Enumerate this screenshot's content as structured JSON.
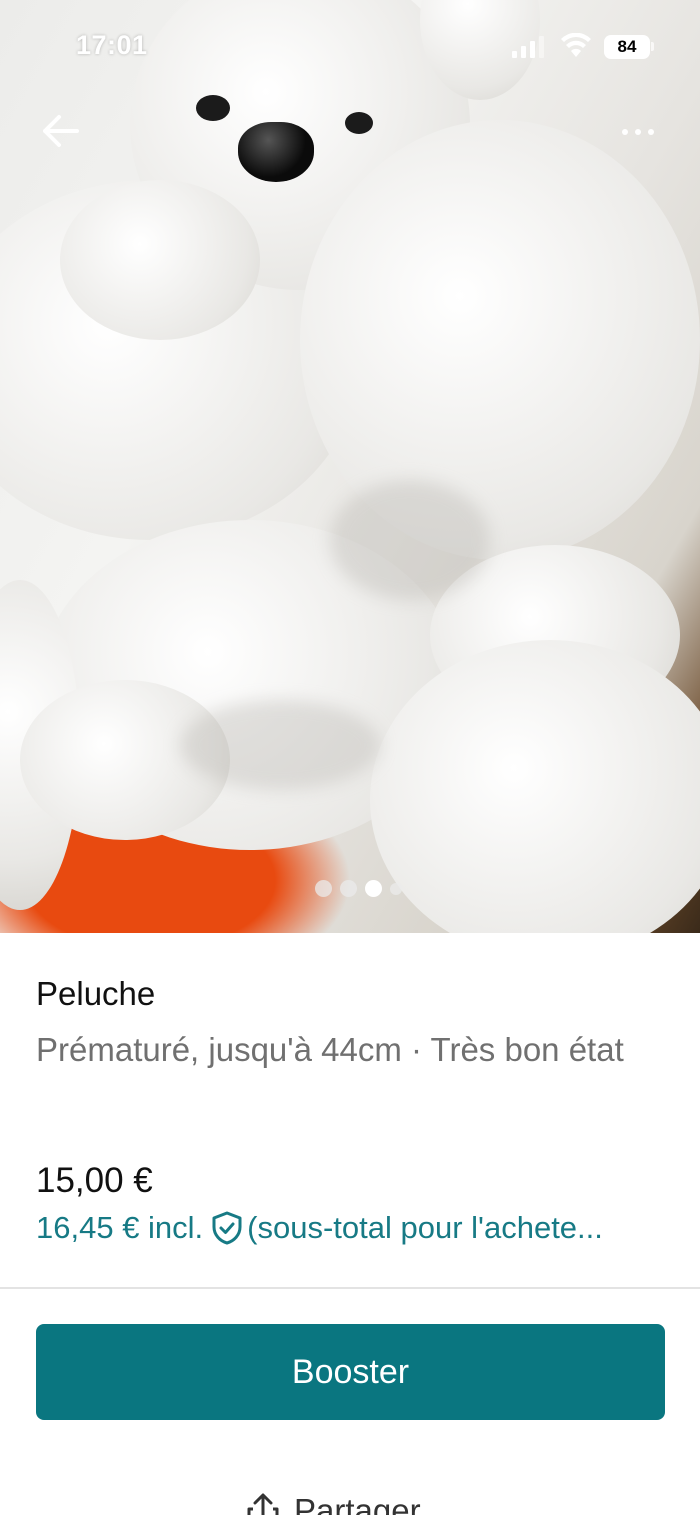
{
  "status_bar": {
    "time": "17:01",
    "battery": "84"
  },
  "nav": {
    "back_icon": "arrow-left-icon",
    "more_icon": "more-horizontal-icon"
  },
  "gallery": {
    "page_count": 4,
    "active_index": 2
  },
  "listing": {
    "title": "Peluche",
    "subtitle": "Prématuré, jusqu'à 44cm · Très bon état",
    "price": "15,00 €",
    "price_incl_amount": "16,45 € incl.",
    "price_incl_note": "(sous-total pour l'achete..."
  },
  "actions": {
    "booster_label": "Booster",
    "share_label": "Partager"
  },
  "colors": {
    "accent": "#0a7680",
    "accent_text": "#177a85"
  }
}
